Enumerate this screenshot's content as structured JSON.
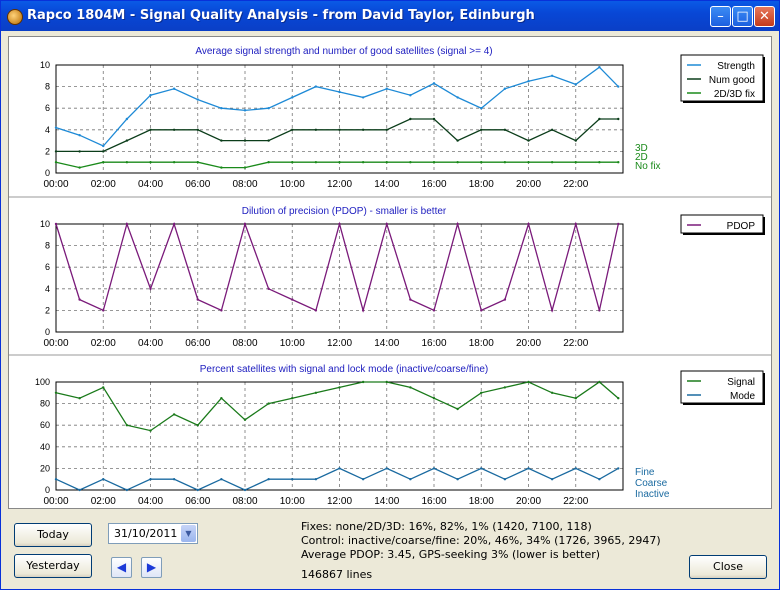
{
  "window": {
    "title": "Rapco 1804M - Signal Quality Analysis - from David Taylor, Edinburgh"
  },
  "time_ticks": [
    "00:00",
    "02:00",
    "04:00",
    "06:00",
    "08:00",
    "10:00",
    "12:00",
    "14:00",
    "16:00",
    "18:00",
    "20:00",
    "22:00"
  ],
  "chart_data": [
    {
      "type": "line",
      "title": "Average signal strength and number of good satellites (signal >= 4)",
      "ylim": [
        0,
        10
      ],
      "yticks": [
        "0",
        "2",
        "4",
        "6",
        "8",
        "10"
      ],
      "x": [
        0,
        1,
        2,
        3,
        4,
        5,
        6,
        7,
        8,
        9,
        10,
        11,
        12,
        13,
        14,
        15,
        16,
        17,
        18,
        19,
        20,
        21,
        22,
        23,
        23.8
      ],
      "series": [
        {
          "name": "Strength",
          "color": "#1e8ad6",
          "values": [
            4.2,
            3.5,
            2.5,
            5.0,
            7.2,
            7.8,
            6.8,
            6.0,
            5.8,
            6.0,
            7.0,
            8.0,
            7.5,
            7.0,
            7.8,
            7.2,
            8.3,
            7.0,
            6.0,
            7.8,
            8.5,
            9.0,
            8.2,
            9.8,
            8.0
          ]
        },
        {
          "name": "Num good",
          "color": "#0b3d1a",
          "values": [
            2,
            2,
            2,
            3,
            4,
            4,
            4,
            3,
            3,
            3,
            4,
            4,
            4,
            4,
            4,
            5,
            5,
            3,
            4,
            4,
            3,
            4,
            3,
            5,
            5
          ]
        },
        {
          "name": "2D/3D fix",
          "color": "#1a8a1a",
          "values": [
            1,
            0.5,
            1,
            1,
            1,
            1,
            1,
            0.5,
            0.5,
            1,
            1,
            1,
            1,
            1,
            1,
            1,
            1,
            1,
            1,
            1,
            1,
            1,
            1,
            1,
            1
          ]
        }
      ],
      "right_labels": [
        "3D",
        "2D",
        "No fix"
      ]
    },
    {
      "type": "line",
      "title": "Dilution of precision (PDOP) - smaller is better",
      "ylim": [
        0,
        10
      ],
      "yticks": [
        "0",
        "2",
        "4",
        "6",
        "8",
        "10"
      ],
      "x": [
        0,
        1,
        2,
        3,
        4,
        5,
        6,
        7,
        8,
        9,
        10,
        11,
        12,
        13,
        14,
        15,
        16,
        17,
        18,
        19,
        20,
        21,
        22,
        23,
        23.8
      ],
      "series": [
        {
          "name": "PDOP",
          "color": "#7a1a7a",
          "values": [
            10,
            3,
            2,
            10,
            4,
            10,
            3,
            2,
            10,
            4,
            3,
            2,
            10,
            2,
            10,
            3,
            2,
            10,
            2,
            3,
            10,
            2,
            10,
            2,
            10
          ]
        }
      ]
    },
    {
      "type": "line",
      "title": "Percent satellites with signal and lock mode (inactive/coarse/fine)",
      "ylim": [
        0,
        100
      ],
      "yticks": [
        "0",
        "20",
        "40",
        "60",
        "80",
        "100"
      ],
      "x": [
        0,
        1,
        2,
        3,
        4,
        5,
        6,
        7,
        8,
        9,
        10,
        11,
        12,
        13,
        14,
        15,
        16,
        17,
        18,
        19,
        20,
        21,
        22,
        23,
        23.8
      ],
      "series": [
        {
          "name": "Signal",
          "color": "#1a7a1a",
          "values": [
            90,
            85,
            95,
            60,
            55,
            70,
            60,
            85,
            65,
            80,
            85,
            90,
            95,
            100,
            100,
            95,
            85,
            75,
            90,
            95,
            100,
            90,
            85,
            100,
            85
          ]
        },
        {
          "name": "Mode",
          "color": "#1a6aa0",
          "values": [
            10,
            0,
            10,
            0,
            10,
            10,
            0,
            10,
            0,
            10,
            10,
            10,
            20,
            10,
            20,
            10,
            20,
            10,
            20,
            10,
            20,
            10,
            20,
            10,
            20
          ]
        }
      ],
      "right_labels": [
        "Fine",
        "Coarse",
        "Inactive"
      ]
    }
  ],
  "controls": {
    "today": "Today",
    "yesterday": "Yesterday",
    "date": "31/10/2011",
    "close": "Close",
    "prev_icon": "left-arrow-icon",
    "next_icon": "right-arrow-icon"
  },
  "stats": {
    "fixes": "Fixes: none/2D/3D:  16%, 82%, 1%  (1420, 7100, 118)",
    "control": "Control: inactive/coarse/fine:  20%, 46%, 34%  (1726, 3965, 2947)",
    "pdop": "Average PDOP: 3.45,  GPS-seeking 3% (lower is better)",
    "lines": "146867 lines"
  }
}
